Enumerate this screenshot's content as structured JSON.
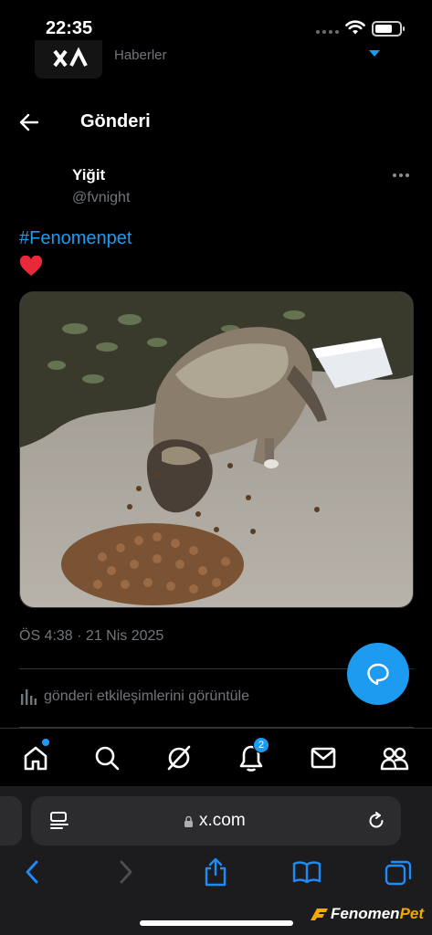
{
  "status_bar": {
    "time": "22:35"
  },
  "peek": {
    "label": "Haberler"
  },
  "header": {
    "title": "Gönderi"
  },
  "post": {
    "author_name": "Yiğit",
    "author_handle": "@fvnight",
    "hashtag": "#Fenomenpet",
    "emoji": "heart",
    "media_description_icon": "dog-photo",
    "timestamp": "ÖS 4:38 · 21 Nis 2025",
    "insights_label": "gönderi etkileşimlerini görüntüle"
  },
  "tab_bar": {
    "items": [
      {
        "icon": "home-icon",
        "has_dot": true
      },
      {
        "icon": "search-icon"
      },
      {
        "icon": "grok-icon"
      },
      {
        "icon": "bell-icon",
        "badge": "2"
      },
      {
        "icon": "mail-icon"
      },
      {
        "icon": "people-icon"
      }
    ]
  },
  "browser": {
    "url": "x.com"
  },
  "watermark": {
    "prefix": "Fenomen",
    "suffix": "Pet"
  },
  "colors": {
    "accent": "#1d9bf0",
    "secondary_text": "#71767b",
    "heart": "#f91880"
  }
}
